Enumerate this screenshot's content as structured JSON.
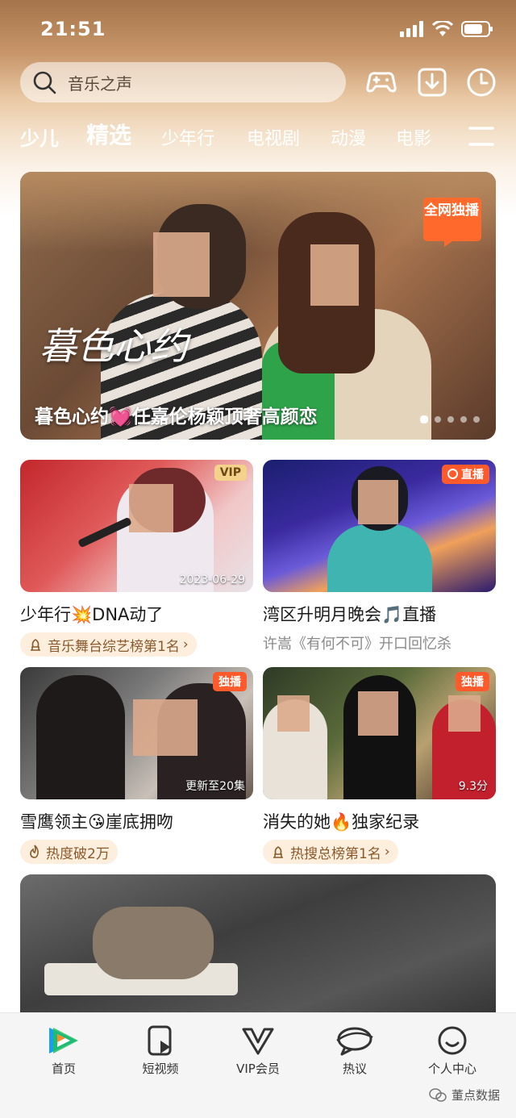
{
  "status": {
    "time": "21:51"
  },
  "search": {
    "placeholder": "音乐之声"
  },
  "top_icons": [
    "game-controller-icon",
    "download-icon",
    "history-icon"
  ],
  "tabs": [
    {
      "label": "少儿",
      "kind": "kids"
    },
    {
      "label": "精选",
      "active": true
    },
    {
      "label": "少年行"
    },
    {
      "label": "电视剧"
    },
    {
      "label": "动漫"
    },
    {
      "label": "电影"
    }
  ],
  "hero": {
    "caption": "暮色心约💓任嘉伦杨颖顶奢高颜恋",
    "badge": "全网独播",
    "logo_text": "暮色心约",
    "dots": 5,
    "active_dot": 0
  },
  "cards": [
    {
      "tag": "VIP",
      "tag_type": "vip",
      "meta": "2023-06-29",
      "title": "少年行💥DNA动了",
      "sub": "音乐舞台综艺榜第1名",
      "sub_type": "rank"
    },
    {
      "tag": "直播",
      "tag_type": "live",
      "meta": "",
      "title": "湾区升明月晚会🎵直播",
      "sub": "许嵩《有何不可》开口回忆杀",
      "sub_type": "plain"
    },
    {
      "tag": "独播",
      "tag_type": "exc",
      "meta": "更新至20集",
      "title": "雪鹰领主😘崖底拥吻",
      "sub": "热度破2万",
      "sub_type": "hot"
    },
    {
      "tag": "独播",
      "tag_type": "exc",
      "meta": "9.3分",
      "title": "消失的她🔥独家纪录",
      "sub": "热搜总榜第1名",
      "sub_type": "rank"
    }
  ],
  "bottom_nav": [
    {
      "label": "首页",
      "icon": "home-logo-icon",
      "active": true
    },
    {
      "label": "短视频",
      "icon": "short-video-icon"
    },
    {
      "label": "VIP会员",
      "icon": "vip-icon"
    },
    {
      "label": "热议",
      "icon": "discussion-icon"
    },
    {
      "label": "个人中心",
      "icon": "profile-icon"
    }
  ],
  "watermark": "董点数据",
  "colors": {
    "accent": "#ff5a2c",
    "vip": "#f4d28c",
    "sub_bg": "#fdeedd"
  }
}
